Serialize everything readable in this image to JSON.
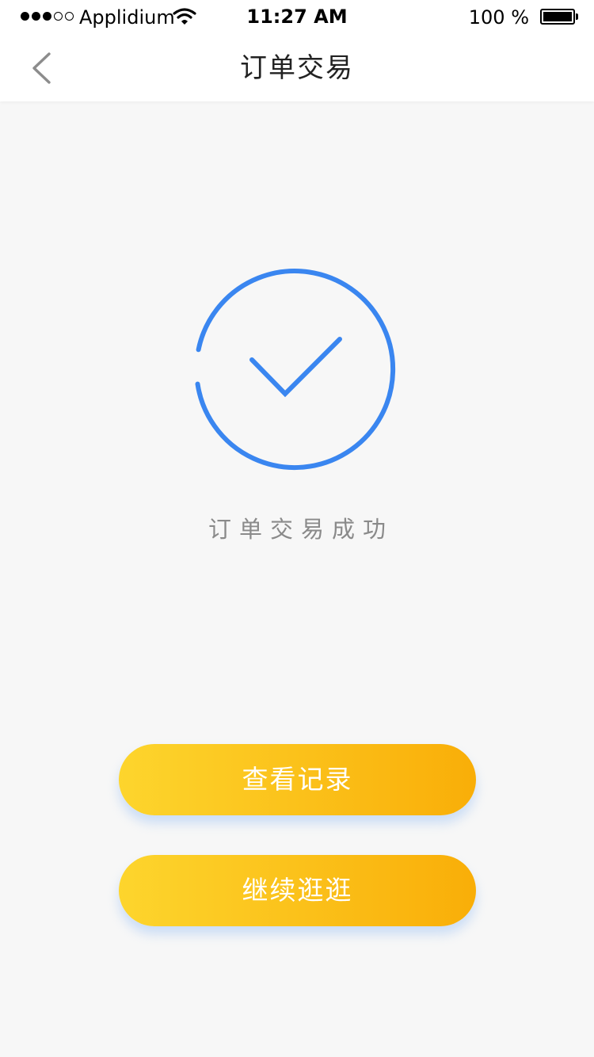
{
  "status_bar": {
    "carrier": "Applidium",
    "time": "11:27 AM",
    "battery": "100 %"
  },
  "nav": {
    "title": "订单交易",
    "back_icon": "chevron-left-icon"
  },
  "result": {
    "icon": "success-check-icon",
    "accent_color": "#3a86f0",
    "message": "订单交易成功"
  },
  "actions": {
    "view_records": "查看记录",
    "continue_shopping": "继续逛逛",
    "gradient": [
      "#fdd52d",
      "#f9ae08"
    ]
  }
}
